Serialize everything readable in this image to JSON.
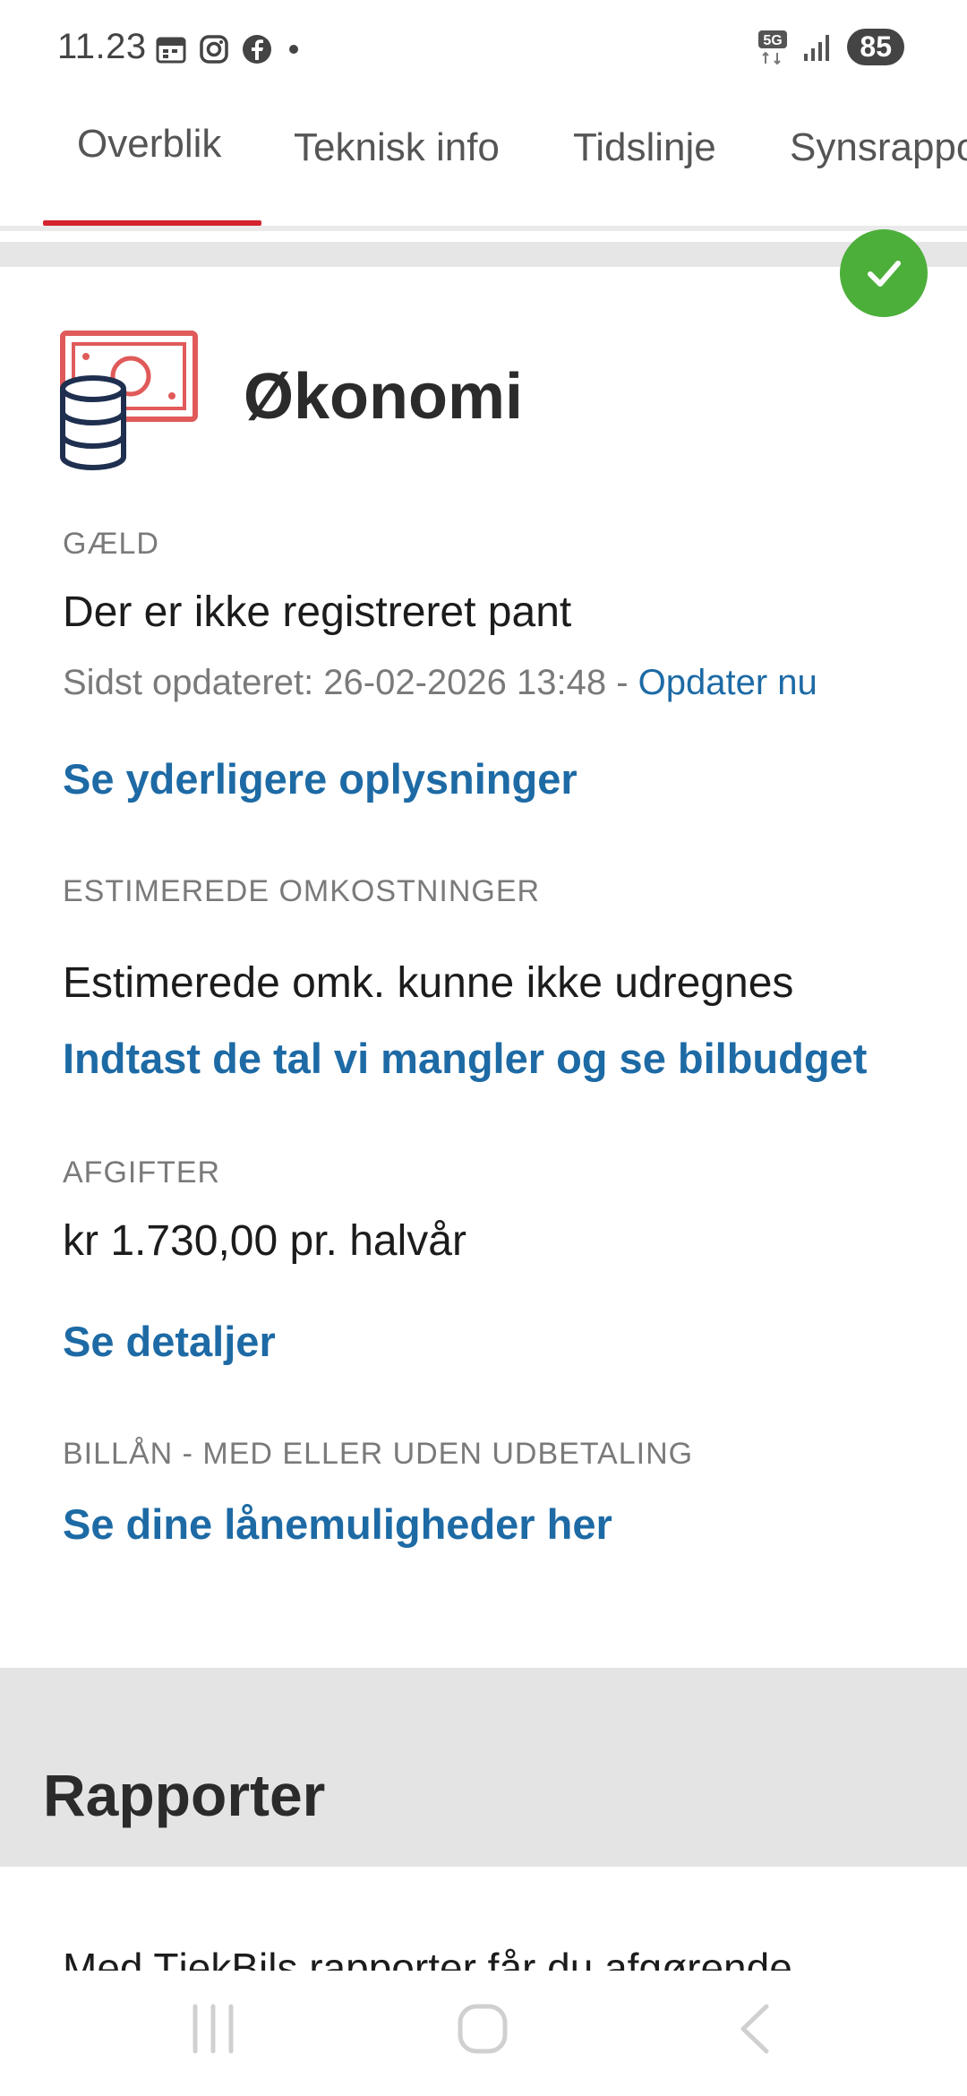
{
  "status_bar": {
    "time": "11.23",
    "icons": [
      "calendar-icon",
      "instagram-icon",
      "facebook-icon",
      "dot-icon"
    ],
    "network": "5G",
    "battery": "85"
  },
  "tabs": [
    {
      "label": "Overblik",
      "active": true
    },
    {
      "label": "Teknisk info",
      "active": false
    },
    {
      "label": "Tidslinje",
      "active": false
    },
    {
      "label": "Synsrapport",
      "active": false
    }
  ],
  "section": {
    "title": "Økonomi",
    "status_icon": "checkmark-icon",
    "accent_color": "#d3232f",
    "success_color": "#4caf3a",
    "link_color": "#1d6aa5"
  },
  "debt": {
    "label": "GÆLD",
    "value": "Der er ikke registreret pant",
    "updated_prefix": "Sidst opdateret: 26-02-2026 13:48 - ",
    "update_link": "Opdater nu",
    "more_link": "Se yderligere oplysninger"
  },
  "costs": {
    "label": "ESTIMEREDE OMKOSTNINGER",
    "value": "Estimerede omk. kunne ikke udregnes",
    "link": "Indtast de tal vi mangler og se bilbudget"
  },
  "fees": {
    "label": "AFGIFTER",
    "value": "kr 1.730,00 pr. halvår",
    "link": "Se detaljer"
  },
  "loan": {
    "label": "BILLÅN - MED ELLER UDEN UDBETALING",
    "link": "Se dine lånemuligheder her"
  },
  "reports": {
    "title": "Rapporter",
    "text": "Med TjekBils rapporter får du afgørende"
  },
  "nav": [
    "recent-apps-icon",
    "home-icon",
    "back-icon"
  ]
}
